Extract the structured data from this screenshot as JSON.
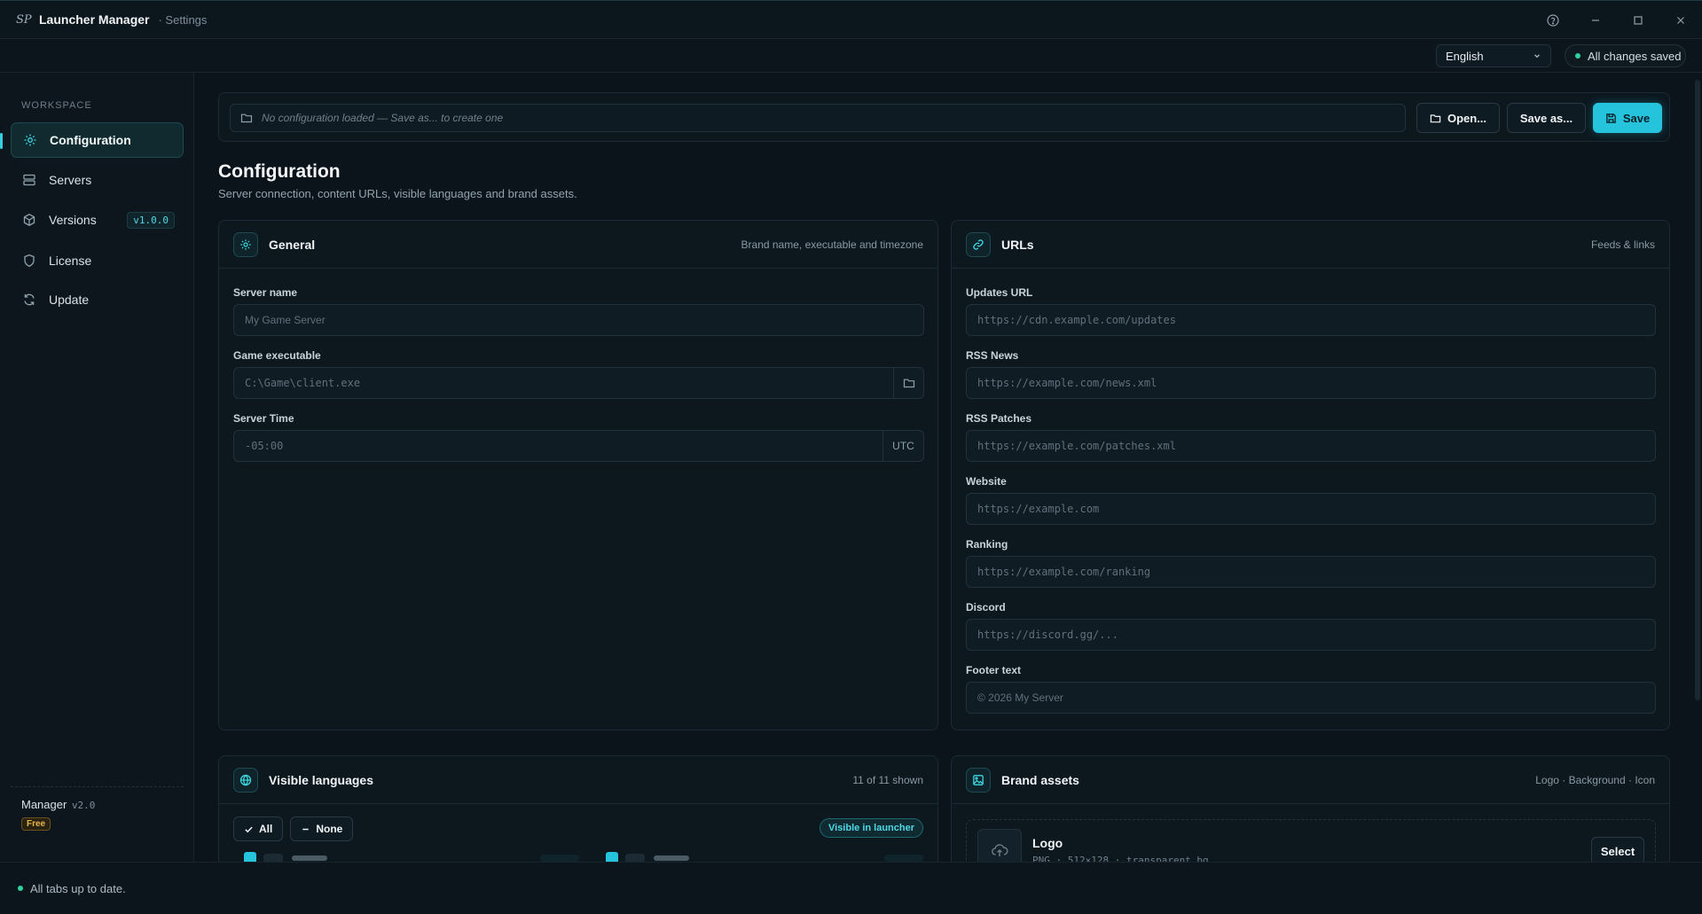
{
  "window": {
    "logo": "SP",
    "title": "Launcher Manager",
    "subtitle": "· Settings"
  },
  "topbar": {
    "language": "English",
    "save_state": "All changes saved"
  },
  "sidebar": {
    "section": "WORKSPACE",
    "items": [
      {
        "label": "Configuration",
        "icon": "gear-icon",
        "active": true
      },
      {
        "label": "Servers",
        "icon": "server-icon"
      },
      {
        "label": "Versions",
        "icon": "cube-icon",
        "badge": "v1.0.0"
      },
      {
        "label": "License",
        "icon": "shield-icon"
      },
      {
        "label": "Update",
        "icon": "refresh-icon"
      }
    ],
    "footer": {
      "name": "Manager",
      "version": "v2.0",
      "plan": "Free"
    }
  },
  "toolbar": {
    "path_placeholder": "No configuration loaded — Save as... to create one",
    "open_label": "Open...",
    "save_as_label": "Save as...",
    "save_label": "Save"
  },
  "page": {
    "title": "Configuration",
    "subtitle": "Server connection, content URLs, visible languages and brand assets."
  },
  "general": {
    "title": "General",
    "hint": "Brand name, executable and timezone",
    "server_name_label": "Server name",
    "server_name_placeholder": "My Game Server",
    "executable_label": "Game executable",
    "executable_placeholder": "C:\\Game\\client.exe",
    "time_label": "Server Time",
    "time_placeholder": "-05:00",
    "time_suffix": "UTC"
  },
  "urls": {
    "title": "URLs",
    "hint": "Feeds & links",
    "fields": [
      {
        "label": "Updates URL",
        "placeholder": "https://cdn.example.com/updates"
      },
      {
        "label": "RSS News",
        "placeholder": "https://example.com/news.xml"
      },
      {
        "label": "RSS Patches",
        "placeholder": "https://example.com/patches.xml"
      },
      {
        "label": "Website",
        "placeholder": "https://example.com"
      },
      {
        "label": "Ranking",
        "placeholder": "https://example.com/ranking"
      },
      {
        "label": "Discord",
        "placeholder": "https://discord.gg/..."
      },
      {
        "label": "Footer text",
        "placeholder": "© 2026 My Server"
      }
    ]
  },
  "languages": {
    "title": "Visible languages",
    "hint": "11 of 11 shown",
    "all_label": "All",
    "none_label": "None",
    "badge": "Visible in launcher"
  },
  "assets": {
    "title": "Brand assets",
    "hint": "Logo · Background · Icon",
    "logo_name": "Logo",
    "logo_meta": "PNG · 512×128 · transparent bg",
    "select_label": "Select"
  },
  "status": {
    "text": "All tabs up to date."
  },
  "colors": {
    "accent": "#25c4dc",
    "success": "#2dd4a0",
    "warning": "#e9b34a"
  }
}
